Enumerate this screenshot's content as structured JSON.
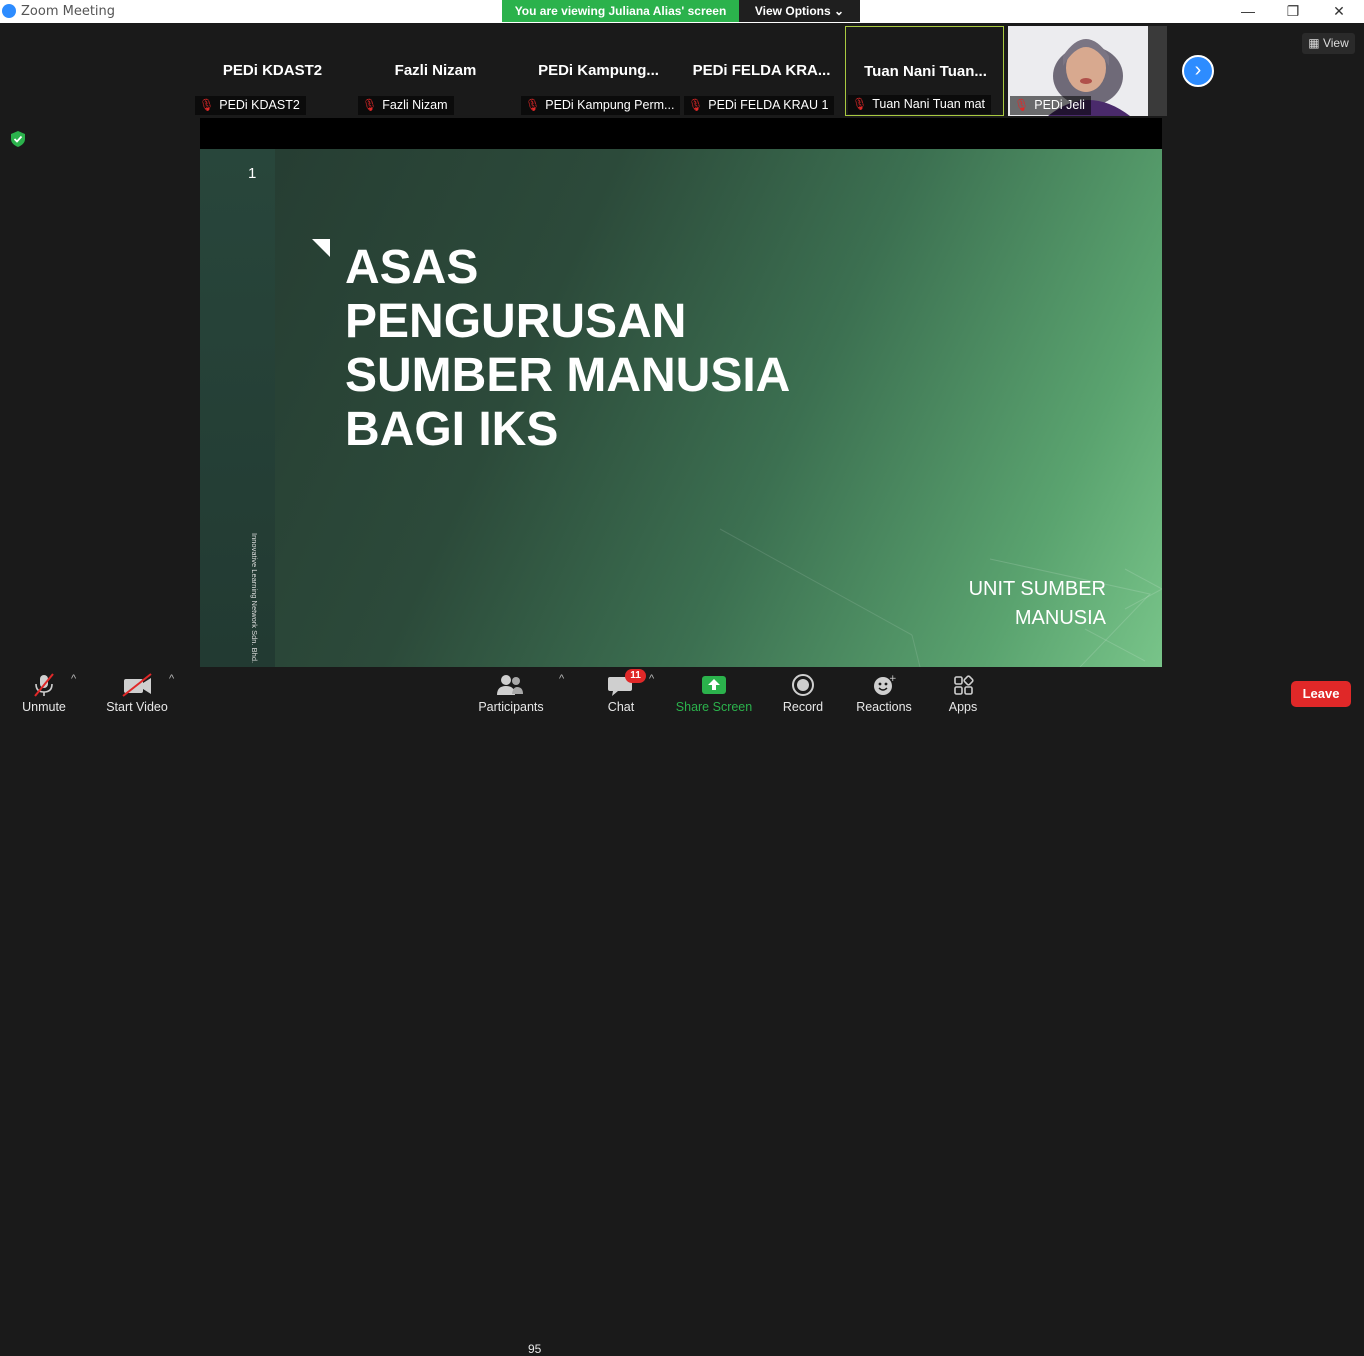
{
  "window": {
    "title": "Zoom Meeting",
    "controls": {
      "minimize": "—",
      "maximize": "❐",
      "close": "✕"
    }
  },
  "banner": {
    "viewing_text": "You are viewing Juliana Alias' screen",
    "view_options_label": "View Options",
    "view_options_chevron": "⌄"
  },
  "gallery": {
    "tiles": [
      {
        "name": "PEDi KDAST2",
        "label": "PEDi KDAST2",
        "muted": true
      },
      {
        "name": "Fazli Nizam",
        "label": "Fazli Nizam",
        "muted": true
      },
      {
        "name": "PEDi  Kampung...",
        "label": "PEDi Kampung Perm...",
        "muted": true
      },
      {
        "name": "PEDi FELDA KRA...",
        "label": "PEDi FELDA KRAU 1",
        "muted": true
      },
      {
        "name": "Tuan  Nani Tuan...",
        "label": "Tuan Nani Tuan mat",
        "muted": true,
        "active": true
      },
      {
        "name": "",
        "label": "PEDi Jeli",
        "muted": true,
        "video": true
      }
    ],
    "next_page_icon": "chevron-right-icon",
    "view_button_label": "View"
  },
  "slide": {
    "page_number": "1",
    "title_lines": [
      "ASAS",
      "PENGURUSAN",
      "SUMBER MANUSIA",
      "BAGI IKS"
    ],
    "subtitle_lines": [
      "UNIT SUMBER",
      "MANUSIA"
    ],
    "vertical_text": "Innovative Learning Network Sdn. Bhd."
  },
  "toolbar": {
    "unmute_label": "Unmute",
    "start_video_label": "Start Video",
    "participants_label": "Participants",
    "participants_count": "95",
    "chat_label": "Chat",
    "chat_badge": "11",
    "share_screen_label": "Share Screen",
    "record_label": "Record",
    "reactions_label": "Reactions",
    "apps_label": "Apps",
    "leave_label": "Leave",
    "caret": "^"
  },
  "colors": {
    "zoom_blue": "#2d8cff",
    "share_green": "#2bb24c",
    "leave_red": "#e02828",
    "muted_red": "#e02828",
    "active_speaker_border": "#a9c940"
  }
}
